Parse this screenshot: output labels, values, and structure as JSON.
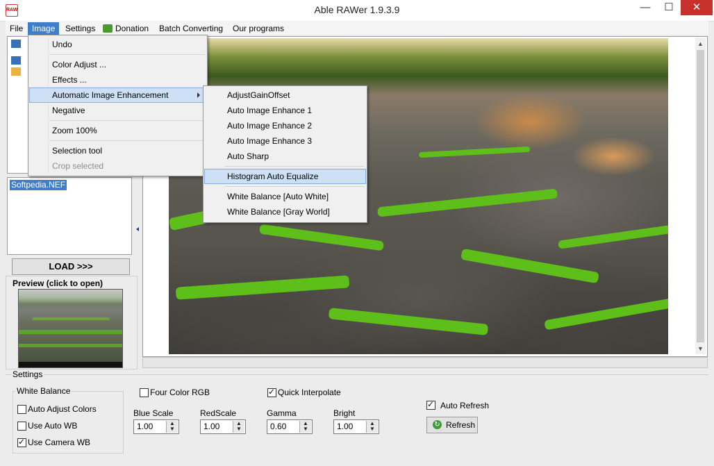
{
  "window": {
    "title": "Able RAWer 1.9.3.9",
    "app_icon_text": "RAW",
    "minimize_glyph": "—",
    "maximize_glyph": "☐",
    "close_glyph": "✕"
  },
  "menubar": {
    "items": [
      "File",
      "Image",
      "Settings",
      "Donation",
      "Batch Converting",
      "Our programs"
    ],
    "active": "Image"
  },
  "image_menu": {
    "items": [
      "Undo",
      "Color Adjust ...",
      "Effects ...",
      "Automatic Image Enhancement",
      "Negative",
      "Zoom 100%",
      "Selection tool",
      "Crop selected"
    ],
    "highlighted": "Automatic Image Enhancement",
    "disabled": [
      "Crop selected"
    ]
  },
  "enhancement_submenu": {
    "items": [
      "AdjustGainOffset",
      "Auto Image Enhance 1",
      "Auto Image Enhance 2",
      "Auto Image Enhance 3",
      "Auto Sharp",
      "Histogram Auto Equalize",
      "White Balance [Auto White]",
      "White Balance [Gray World]"
    ],
    "highlighted": "Histogram Auto Equalize"
  },
  "left_panel": {
    "file_list": [
      "Softpedia.NEF"
    ],
    "selected_file": "Softpedia.NEF",
    "load_button": "LOAD >>>",
    "preview_label": "Preview (click to open)"
  },
  "settings": {
    "group_label": "Settings",
    "white_balance": {
      "label": "White Balance",
      "auto_adjust_colors": {
        "label": "Auto Adjust Colors",
        "checked": false
      },
      "use_auto_wb": {
        "label": "Use Auto WB",
        "checked": false
      },
      "use_camera_wb": {
        "label": "Use Camera WB",
        "checked": true
      }
    },
    "four_color_rgb": {
      "label": "Four Color RGB",
      "checked": false
    },
    "quick_interpolate": {
      "label": "Quick Interpolate",
      "checked": true
    },
    "auto_refresh": {
      "label": "Auto Refresh",
      "checked": true
    },
    "blue_scale": {
      "label": "Blue Scale",
      "value": "1.00"
    },
    "red_scale": {
      "label": "RedScale",
      "value": "1.00"
    },
    "gamma": {
      "label": "Gamma",
      "value": "0.60"
    },
    "bright": {
      "label": "Bright",
      "value": "1.00"
    },
    "refresh_button": "Refresh"
  },
  "colors": {
    "menu_highlight": "#cde0f5",
    "selection_blue": "#3f7fc7",
    "close_red": "#c7312b"
  }
}
